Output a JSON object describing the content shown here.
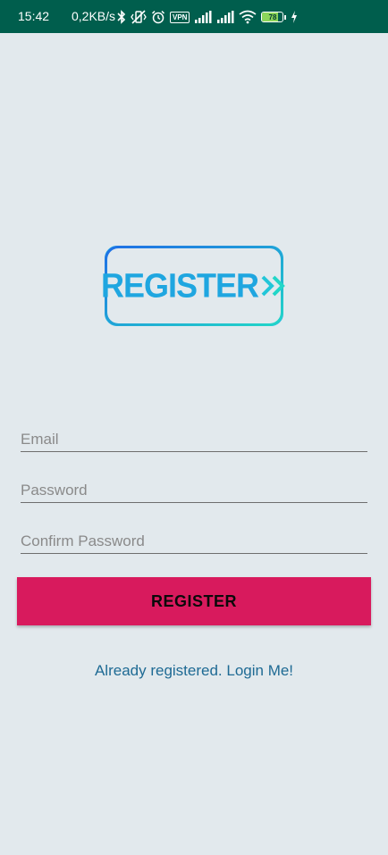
{
  "status_bar": {
    "time": "15:42",
    "network_speed": "0,2KB/s",
    "vpn_label": "VPN",
    "battery_level": "78",
    "battery_fraction": 0.78,
    "icons": [
      "bluetooth-icon",
      "vibrate-off-icon",
      "alarm-icon",
      "vpn-icon",
      "signal-icon",
      "signal-icon",
      "wifi-icon",
      "battery-icon",
      "charging-icon"
    ],
    "background_color": "#005e4d"
  },
  "logo": {
    "text": "REGISTER",
    "arrows_icon": "double-chevron-right-icon",
    "gradient_colors": [
      "#1f6fe6",
      "#22d6c8"
    ]
  },
  "form": {
    "email_placeholder": "Email",
    "password_placeholder": "Password",
    "confirm_password_placeholder": "Confirm Password"
  },
  "register_button": {
    "label": "REGISTER",
    "color": "#d81a5d"
  },
  "login_link": {
    "text": "Already registered. Login Me!",
    "color": "#1e6a94"
  },
  "background_color": "#e2e9ed"
}
